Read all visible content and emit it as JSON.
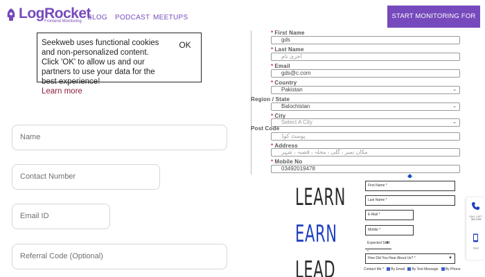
{
  "header": {
    "logo_text": "LogRocket",
    "logo_sub": "Frontend Monitoring",
    "nav": [
      "BLOG",
      "PODCAST",
      "MEETUPS"
    ],
    "cta": "START MONITORING FOR FREE",
    "brand_color": "#764abc"
  },
  "cookie": {
    "text": "Seekweb uses functional cookies and non-personalized content. Click 'OK' to allow us and our partners to use your data for the best experience!",
    "learn_more": "Learn more",
    "ok": "OK"
  },
  "left_form": {
    "name_placeholder": "Name",
    "contact_placeholder": "Contact Number",
    "email_placeholder": "Email ID",
    "referral_placeholder": "Referral Code (Optional)"
  },
  "middle_form": {
    "first_name_label": "First Name",
    "first_name_value": "gds",
    "last_name_label": "Last Name",
    "last_name_value": "آخری نام",
    "email_label": "Email",
    "email_value": "gds@c.com",
    "country_label": "Country",
    "country_value": "Pakistan",
    "region_label": "Region / State",
    "region_value": "Balochistan",
    "city_label": "City",
    "city_value": "Select A City",
    "postcode_label": "Post Code",
    "postcode_value": "پوسٹ کوڈ",
    "address_label": "Address",
    "address_value": "مکان نمبر ، گلی ، محلہ ، قصبہ ، شہر",
    "mobile_label": "Mobile No",
    "mobile_value": "03492019478"
  },
  "big_words": [
    "LEARN",
    "EARN",
    "LEAD"
  ],
  "small_form": {
    "first_name": "First Name *",
    "last_name": "Last Name *",
    "email": "E-Mail *",
    "mobile": "Mobile *",
    "expected_start": "Expected Start *",
    "hear_about": "How Did You Hear About Us? *",
    "contact_label": "Contact Me *",
    "contact_opts": [
      "By Email",
      "By Text Message",
      "By Phone"
    ]
  },
  "float_bar": {
    "call_label": "CALL 1-877-354-5785",
    "text_label": "TEXT"
  }
}
